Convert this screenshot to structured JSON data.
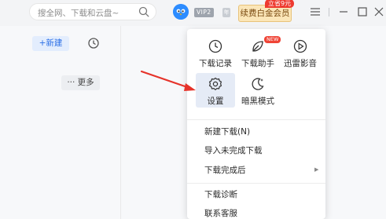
{
  "titlebar": {
    "search_placeholder": "搜全网、下载和云盘~",
    "vip_label": "VIP2",
    "vip_extra": "年",
    "renew_label": "续费白金会员",
    "promo_tag": "立省9元"
  },
  "left_panel": {
    "new_label": "+新建",
    "more_label": "··· 更多"
  },
  "menu": {
    "tools": [
      {
        "label": "下载记录",
        "icon": "history-icon"
      },
      {
        "label": "下载助手",
        "icon": "helper-icon",
        "badge": "NEW"
      },
      {
        "label": "迅雷影音",
        "icon": "player-icon"
      },
      {
        "label": "设置",
        "icon": "gear-icon"
      },
      {
        "label": "暗黑模式",
        "icon": "moon-icon"
      }
    ],
    "items": [
      {
        "label": "新建下载(N)"
      },
      {
        "label": "导入未完成下载"
      },
      {
        "label": "下载完成后",
        "has_submenu": true
      },
      {
        "label": "下载诊断"
      },
      {
        "label": "联系客服"
      }
    ]
  },
  "colors": {
    "accent": "#2b6fe6",
    "arrow": "#e6332a",
    "renew_bg": "#fbe6b8",
    "promo": "#ee3a2f"
  }
}
